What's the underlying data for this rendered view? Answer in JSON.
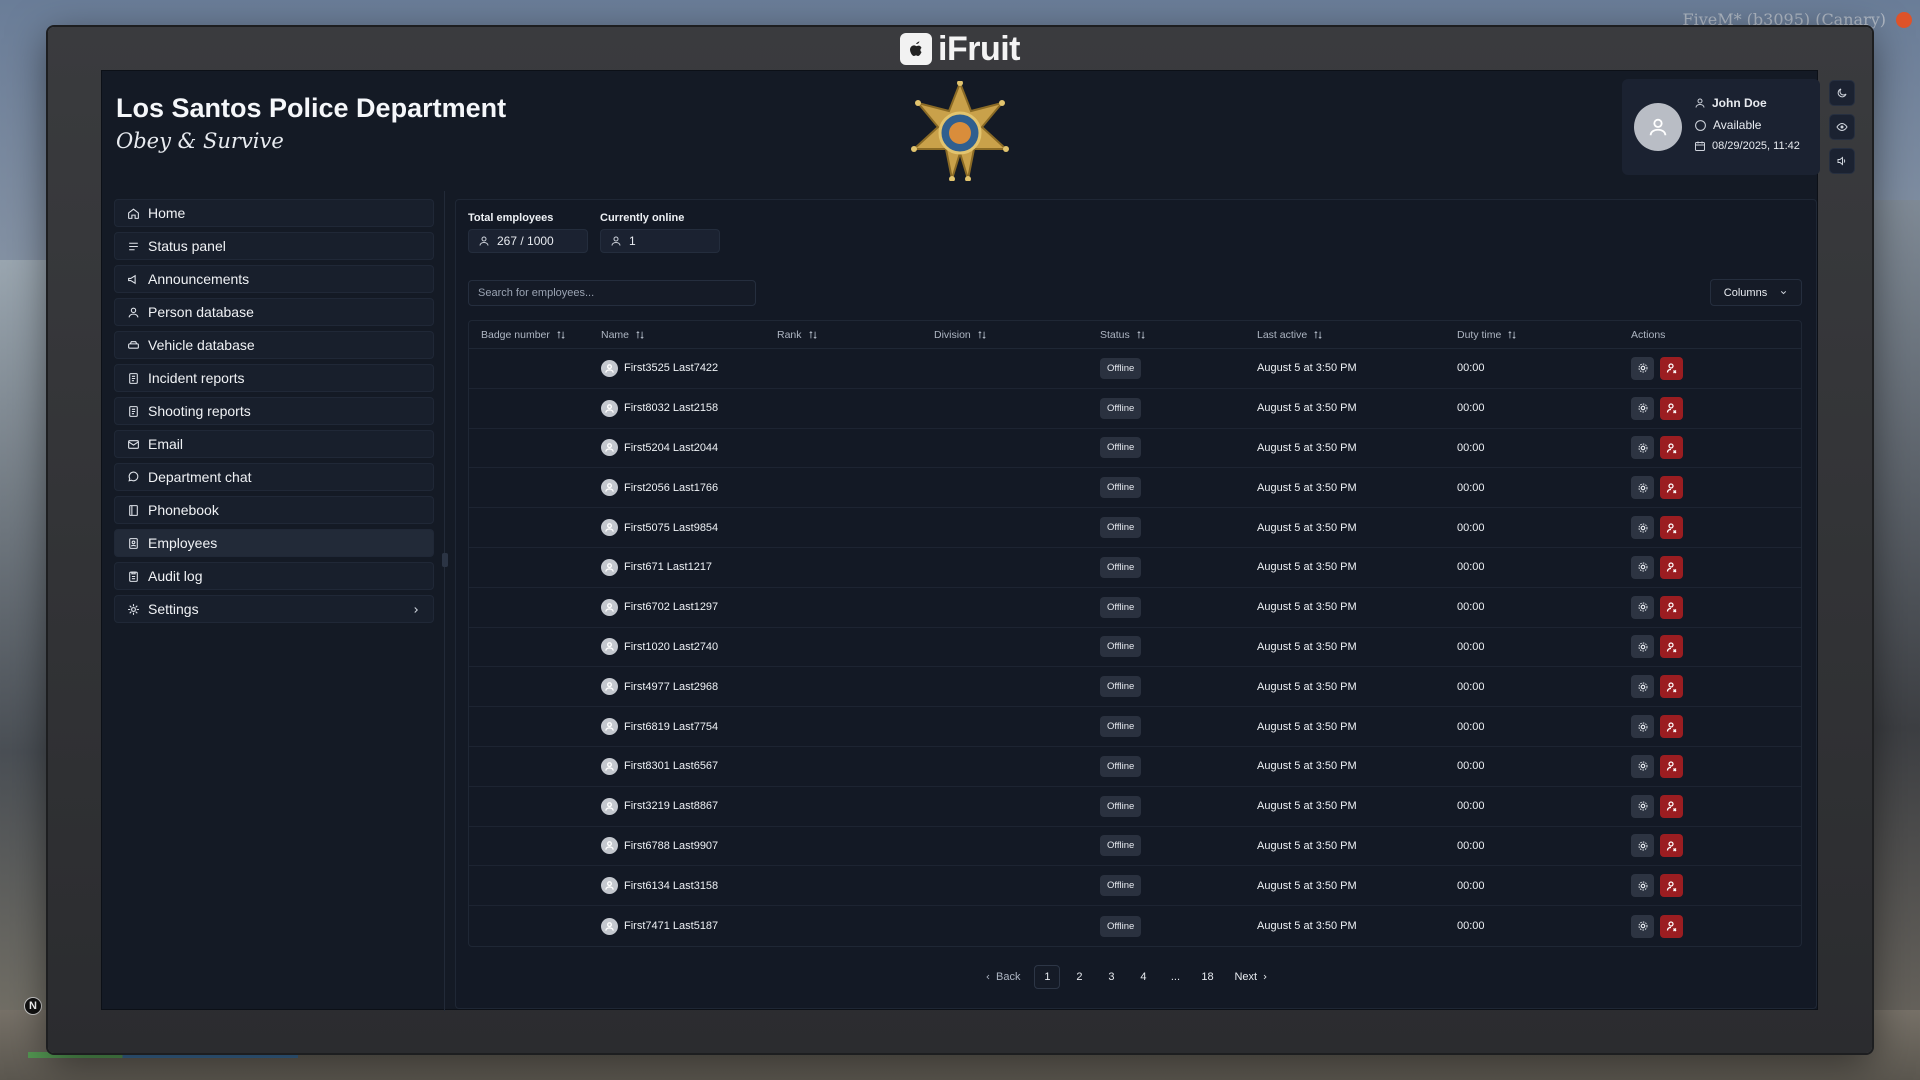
{
  "overlay": {
    "fivem_label": "FiveM* (b3095) (Canary)",
    "bottom_badge": "N"
  },
  "brand": {
    "name": "iFruit"
  },
  "header": {
    "title": "Los Santos Police Department",
    "motto": "Obey & Survive"
  },
  "user": {
    "name": "John Doe",
    "status": "Available",
    "datetime": "08/29/2025, 11:42"
  },
  "sidebar": {
    "items": [
      {
        "label": "Home",
        "icon": "home-icon"
      },
      {
        "label": "Status panel",
        "icon": "list-icon"
      },
      {
        "label": "Announcements",
        "icon": "megaphone-icon"
      },
      {
        "label": "Person database",
        "icon": "user-icon"
      },
      {
        "label": "Vehicle database",
        "icon": "car-icon"
      },
      {
        "label": "Incident reports",
        "icon": "document-icon"
      },
      {
        "label": "Shooting reports",
        "icon": "document-icon"
      },
      {
        "label": "Email",
        "icon": "mail-icon"
      },
      {
        "label": "Department chat",
        "icon": "chat-icon"
      },
      {
        "label": "Phonebook",
        "icon": "book-icon"
      },
      {
        "label": "Employees",
        "icon": "id-card-icon",
        "active": true
      },
      {
        "label": "Audit log",
        "icon": "clipboard-icon"
      },
      {
        "label": "Settings",
        "icon": "gear-icon",
        "chevron": true
      }
    ]
  },
  "stats": {
    "total_label": "Total employees",
    "total_value": "267 / 1000",
    "online_label": "Currently online",
    "online_value": "1"
  },
  "search": {
    "placeholder": "Search for employees..."
  },
  "columns_button": "Columns",
  "table": {
    "headers": [
      "Badge number",
      "Name",
      "Rank",
      "Division",
      "Status",
      "Last active",
      "Duty time",
      "Actions"
    ],
    "rows": [
      {
        "badge": "",
        "name": "First3525 Last7422",
        "rank": "",
        "division": "",
        "status": "Offline",
        "last_active": "August 5 at 3:50 PM",
        "duty_time": "00:00"
      },
      {
        "badge": "",
        "name": "First8032 Last2158",
        "rank": "",
        "division": "",
        "status": "Offline",
        "last_active": "August 5 at 3:50 PM",
        "duty_time": "00:00"
      },
      {
        "badge": "",
        "name": "First5204 Last2044",
        "rank": "",
        "division": "",
        "status": "Offline",
        "last_active": "August 5 at 3:50 PM",
        "duty_time": "00:00"
      },
      {
        "badge": "",
        "name": "First2056 Last1766",
        "rank": "",
        "division": "",
        "status": "Offline",
        "last_active": "August 5 at 3:50 PM",
        "duty_time": "00:00"
      },
      {
        "badge": "",
        "name": "First5075 Last9854",
        "rank": "",
        "division": "",
        "status": "Offline",
        "last_active": "August 5 at 3:50 PM",
        "duty_time": "00:00"
      },
      {
        "badge": "",
        "name": "First671 Last1217",
        "rank": "",
        "division": "",
        "status": "Offline",
        "last_active": "August 5 at 3:50 PM",
        "duty_time": "00:00"
      },
      {
        "badge": "",
        "name": "First6702 Last1297",
        "rank": "",
        "division": "",
        "status": "Offline",
        "last_active": "August 5 at 3:50 PM",
        "duty_time": "00:00"
      },
      {
        "badge": "",
        "name": "First1020 Last2740",
        "rank": "",
        "division": "",
        "status": "Offline",
        "last_active": "August 5 at 3:50 PM",
        "duty_time": "00:00"
      },
      {
        "badge": "",
        "name": "First4977 Last2968",
        "rank": "",
        "division": "",
        "status": "Offline",
        "last_active": "August 5 at 3:50 PM",
        "duty_time": "00:00"
      },
      {
        "badge": "",
        "name": "First6819 Last7754",
        "rank": "",
        "division": "",
        "status": "Offline",
        "last_active": "August 5 at 3:50 PM",
        "duty_time": "00:00"
      },
      {
        "badge": "",
        "name": "First8301 Last6567",
        "rank": "",
        "division": "",
        "status": "Offline",
        "last_active": "August 5 at 3:50 PM",
        "duty_time": "00:00"
      },
      {
        "badge": "",
        "name": "First3219 Last8867",
        "rank": "",
        "division": "",
        "status": "Offline",
        "last_active": "August 5 at 3:50 PM",
        "duty_time": "00:00"
      },
      {
        "badge": "",
        "name": "First6788 Last9907",
        "rank": "",
        "division": "",
        "status": "Offline",
        "last_active": "August 5 at 3:50 PM",
        "duty_time": "00:00"
      },
      {
        "badge": "",
        "name": "First6134 Last3158",
        "rank": "",
        "division": "",
        "status": "Offline",
        "last_active": "August 5 at 3:50 PM",
        "duty_time": "00:00"
      },
      {
        "badge": "",
        "name": "First7471 Last5187",
        "rank": "",
        "division": "",
        "status": "Offline",
        "last_active": "August 5 at 3:50 PM",
        "duty_time": "00:00"
      }
    ]
  },
  "pagination": {
    "back": "Back",
    "pages": [
      "1",
      "2",
      "3",
      "4",
      "...",
      "18"
    ],
    "active_page": "1",
    "next": "Next"
  },
  "colors": {
    "accent_red": "#9b1d21",
    "panel_bg": "#141a25"
  }
}
